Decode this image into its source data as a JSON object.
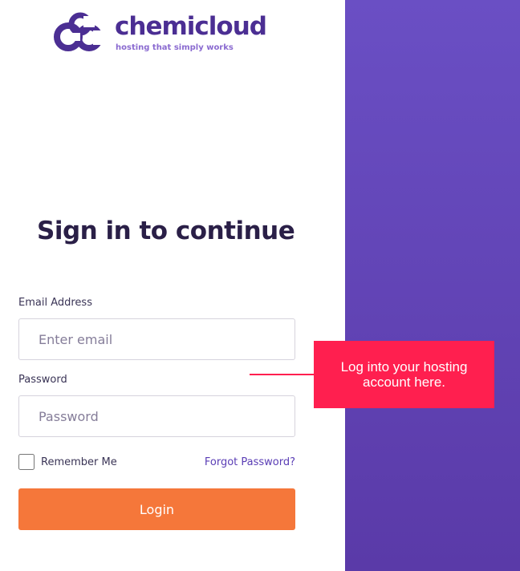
{
  "brand": {
    "name": "chemicloud",
    "tagline": "hosting that simply works",
    "logo_icon": "ccc-logo-icon",
    "color": "#4b2e93",
    "tagline_color": "#8a6ad0"
  },
  "login": {
    "title": "Sign in to continue",
    "email": {
      "label": "Email Address",
      "placeholder": "Enter email",
      "value": ""
    },
    "password": {
      "label": "Password",
      "placeholder": "Password",
      "value": ""
    },
    "remember_me": {
      "label": "Remember Me",
      "checked": false
    },
    "forgot_password": "Forgot Password?",
    "submit_label": "Login"
  },
  "callout": {
    "text": "Log into your hosting account here.",
    "color": "#ff1f4f"
  },
  "colors": {
    "accent_button": "#f5773a",
    "side_panel": "#6a4fc4",
    "link": "#5a3db5"
  }
}
